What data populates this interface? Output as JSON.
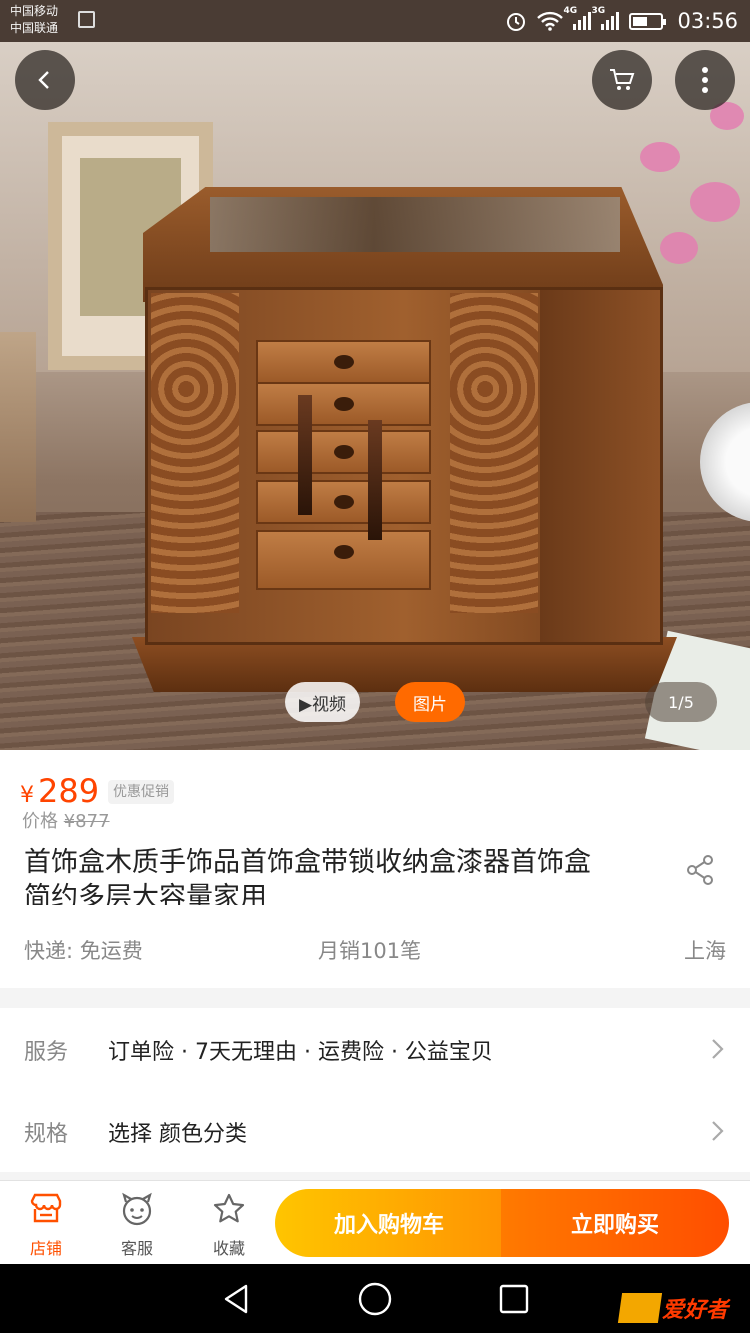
{
  "status_bar": {
    "carrier_1": "中国移动",
    "carrier_2": "中国联通",
    "net_1": "4G",
    "net_2": "3G",
    "time": "03:56",
    "icons": [
      "photo-icon",
      "alarm-icon",
      "wifi-icon",
      "signal-icon",
      "battery-icon"
    ]
  },
  "gallery": {
    "video_label": "▶视频",
    "photo_label": "图片",
    "counter": "1/5",
    "current_index": 1,
    "total": 5
  },
  "product": {
    "currency": "¥",
    "price": "289",
    "promo_badge": "优惠促销",
    "original_label": "价格",
    "original_price": "¥877",
    "title": "首饰盒木质手饰品首饰盒带锁收纳盒漆器首饰盒简约多层大容量家用",
    "shipping": "快递: 免运费",
    "monthly_sales": "月销101笔",
    "location": "上海"
  },
  "service": {
    "label": "服务",
    "value": "订单险 · 7天无理由 · 运费险 · 公益宝贝"
  },
  "spec": {
    "label": "规格",
    "value": "选择 颜色分类"
  },
  "action_bar": {
    "shop": "店铺",
    "customer_service": "客服",
    "favorite": "收藏",
    "add_to_cart": "加入购物车",
    "buy_now": "立即购买"
  },
  "watermark": {
    "text": "爱好者"
  },
  "colors": {
    "accent_orange": "#ff5000",
    "price_red": "#ff4400",
    "cart_gradient": [
      "#ffc500",
      "#ff9402"
    ],
    "buy_gradient": [
      "#ff7a00",
      "#ff4e00"
    ]
  }
}
